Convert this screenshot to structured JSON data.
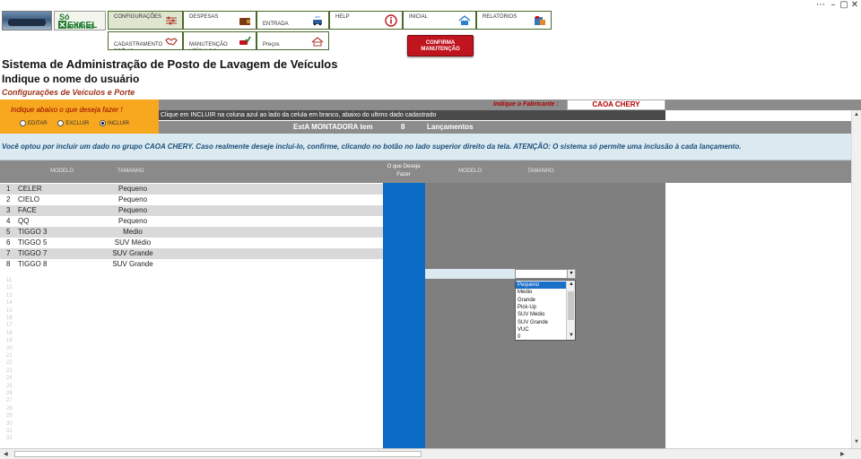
{
  "window": {
    "controls": [
      "⋯",
      "–",
      "▢",
      "✕"
    ]
  },
  "logo": {
    "line1": "Só Planilhas",
    "line2": "EXCEL"
  },
  "nav": {
    "row1": [
      {
        "label": "CONFIGURAÇÕES",
        "icon": "sliders-icon",
        "active": true
      },
      {
        "label": "DESPESAS",
        "icon": "wallet-icon"
      },
      {
        "label": "ENTRADA\nSERVIÇO",
        "icon": "car-wash-icon"
      },
      {
        "label": "HELP",
        "icon": "info-icon"
      },
      {
        "label": "INICIAL",
        "icon": "home-icon"
      },
      {
        "label": "RELATÓRIOS",
        "icon": "report-icon"
      }
    ],
    "row2": [
      {
        "label": "CADASTRAMENTO\nPRÉVIO",
        "icon": "handshake-icon"
      },
      {
        "label": "MANUTENÇÃO\nVEÍCULOS",
        "icon": "check-car-icon"
      },
      {
        "label": "Preços\nServiços",
        "icon": "price-icon"
      }
    ]
  },
  "confirm_button": "CONFIRMA\nMANUTENÇÃO",
  "titles": {
    "main": "Sistema de Administração de Posto de Lavagem de Veículos",
    "user": "Indique o nome do usuário",
    "sub": "Configurações de Veículos e Porte"
  },
  "manufacturer": {
    "label": "Indique o Fabricante :",
    "value": "CAOA CHERY"
  },
  "action": {
    "prompt": "Indique abaixo o que deseja fazer !",
    "options": [
      {
        "label": "EDITAR",
        "checked": false
      },
      {
        "label": "EXCLUIR",
        "checked": false
      },
      {
        "label": "INCLUIR",
        "checked": true
      }
    ]
  },
  "instruction": "Clique em INCLUIR na coluna azul ao lado da celula em branco, abaixo do ultimo dado cadastrado",
  "count": {
    "prefix": "EstA MONTADORA tem",
    "value": "8",
    "suffix": "Lançamentos"
  },
  "message": "Você optou por incluir um dado no grupo CAOA CHERY. Caso realmente deseje incluí-lo, confirme, clicando no botão no lado superior direito da tela. ATENÇÃO: O sistema só permite uma inclusão à cada lançamento.",
  "table": {
    "headers": {
      "modelo": "MODELO",
      "tamanho": "TAMANHO",
      "acao": "O que Deseja\nFazer",
      "modelo2": "MODELO",
      "tamanho2": "TAMANHO"
    },
    "rows": [
      {
        "n": "1",
        "modelo": "CELER",
        "tamanho": "Pequeno"
      },
      {
        "n": "2",
        "modelo": "CIELO",
        "tamanho": "Pequeno"
      },
      {
        "n": "3",
        "modelo": "FACE",
        "tamanho": "Pequeno"
      },
      {
        "n": "4",
        "modelo": "QQ",
        "tamanho": "Pequeno"
      },
      {
        "n": "5",
        "modelo": "TIGGO 3",
        "tamanho": "Medio"
      },
      {
        "n": "6",
        "modelo": "TIGGO 5",
        "tamanho": "SUV Médio"
      },
      {
        "n": "7",
        "modelo": "TIGGO 7",
        "tamanho": "SUV Grande"
      },
      {
        "n": "8",
        "modelo": "TIGGO 8",
        "tamanho": "SUV Grande"
      }
    ],
    "empty_rows": [
      "11",
      "12",
      "13",
      "14",
      "15",
      "16",
      "17",
      "18",
      "19",
      "20",
      "21",
      "22",
      "23",
      "24",
      "25",
      "26",
      "27",
      "28",
      "29",
      "30",
      "31",
      "32",
      "33"
    ]
  },
  "dropdown": {
    "options": [
      "Pequeno",
      "Médio",
      "Grande",
      "Pick-Up",
      "SUV Médio",
      "SUV Grande",
      "VUC",
      "0"
    ],
    "selected_index": 0
  },
  "scrollbar": {
    "up": "▲",
    "down": "▼",
    "left": "◀",
    "right": "▶"
  }
}
